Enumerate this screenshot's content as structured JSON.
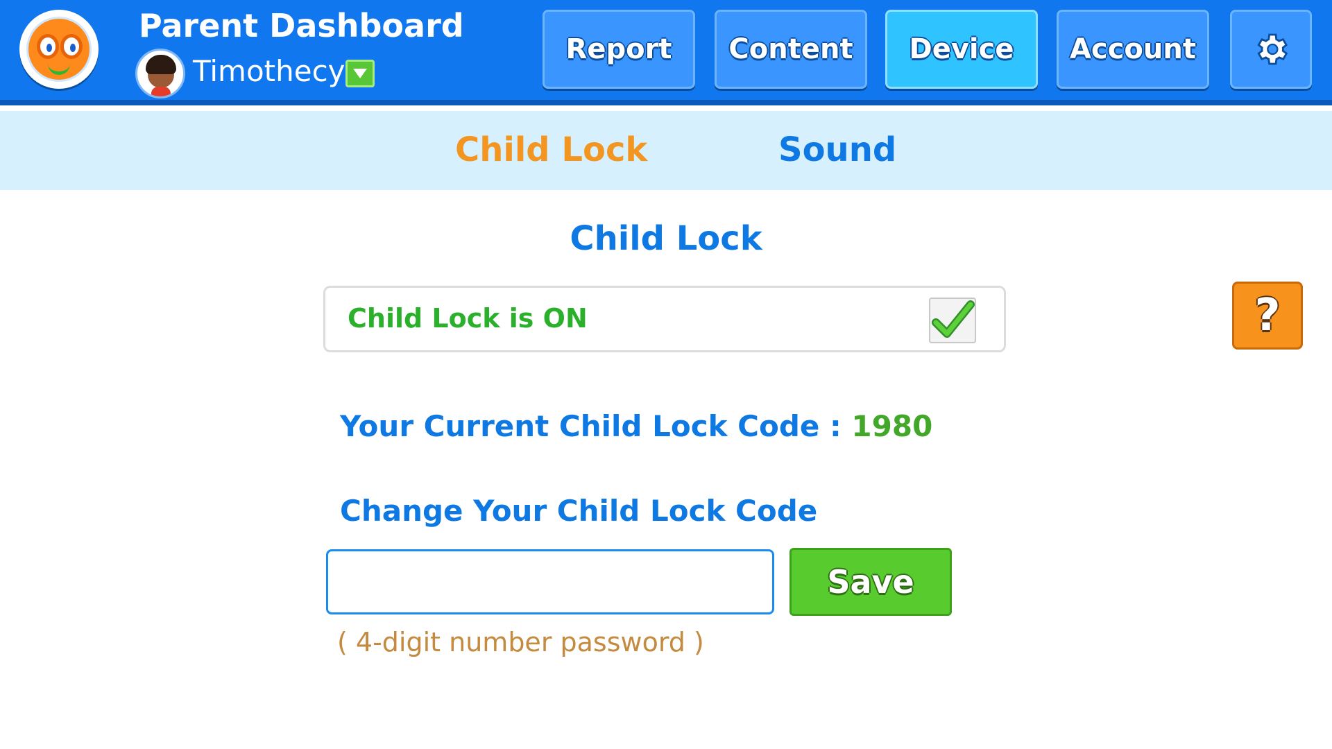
{
  "header": {
    "title": "Parent Dashboard",
    "child_name": "Timothecy",
    "nav": {
      "report": "Report",
      "content": "Content",
      "device": "Device",
      "account": "Account"
    },
    "active_nav": "Device",
    "brand_color": "#1177ee"
  },
  "subtabs": {
    "child_lock": "Child Lock",
    "sound": "Sound",
    "active": "Child Lock"
  },
  "main": {
    "section_title": "Child Lock",
    "status_text": "Child Lock is ON",
    "child_lock_enabled": true,
    "current_code_label": "Your Current Child Lock Code : ",
    "current_code_value": "1980",
    "change_title": "Change Your Child Lock Code",
    "input_value": "",
    "save_label": "Save",
    "hint": "( 4-digit number password )",
    "help_label": "?"
  },
  "icons": {
    "logo": "owl-logo-icon",
    "avatar": "child-avatar-icon",
    "dropdown": "chevron-down-icon",
    "settings": "gear-icon",
    "checkbox": "checkmark-icon",
    "help": "question-mark-icon"
  }
}
